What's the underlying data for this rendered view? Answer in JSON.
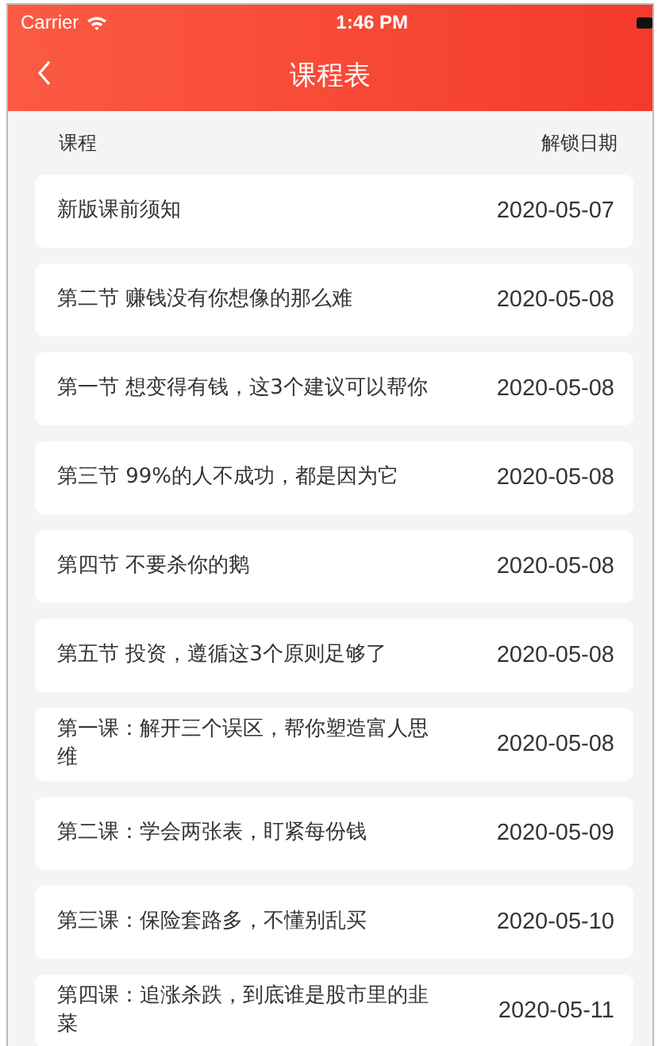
{
  "status_bar": {
    "carrier": "Carrier",
    "time": "1:46 PM"
  },
  "nav": {
    "title": "课程表"
  },
  "columns": [
    "课程",
    "解锁日期"
  ],
  "rows": [
    {
      "course": "新版课前须知",
      "date": "2020-05-07"
    },
    {
      "course": "第二节 赚钱没有你想像的那么难",
      "date": "2020-05-08"
    },
    {
      "course": "第一节 想变得有钱，这3个建议可以帮你",
      "date": "2020-05-08"
    },
    {
      "course": "第三节 99%的人不成功，都是因为它",
      "date": "2020-05-08"
    },
    {
      "course": "第四节 不要杀你的鹅",
      "date": "2020-05-08"
    },
    {
      "course": "第五节 投资，遵循这3个原则足够了",
      "date": "2020-05-08"
    },
    {
      "course": "第一课：解开三个误区，帮你塑造富人思维",
      "date": "2020-05-08"
    },
    {
      "course": "第二课：学会两张表，盯紧每份钱",
      "date": "2020-05-09"
    },
    {
      "course": "第三课：保险套路多，不懂别乱买",
      "date": "2020-05-10"
    },
    {
      "course": "第四课：追涨杀跌，到底谁是股市里的韭菜",
      "date": "2020-05-11"
    }
  ]
}
